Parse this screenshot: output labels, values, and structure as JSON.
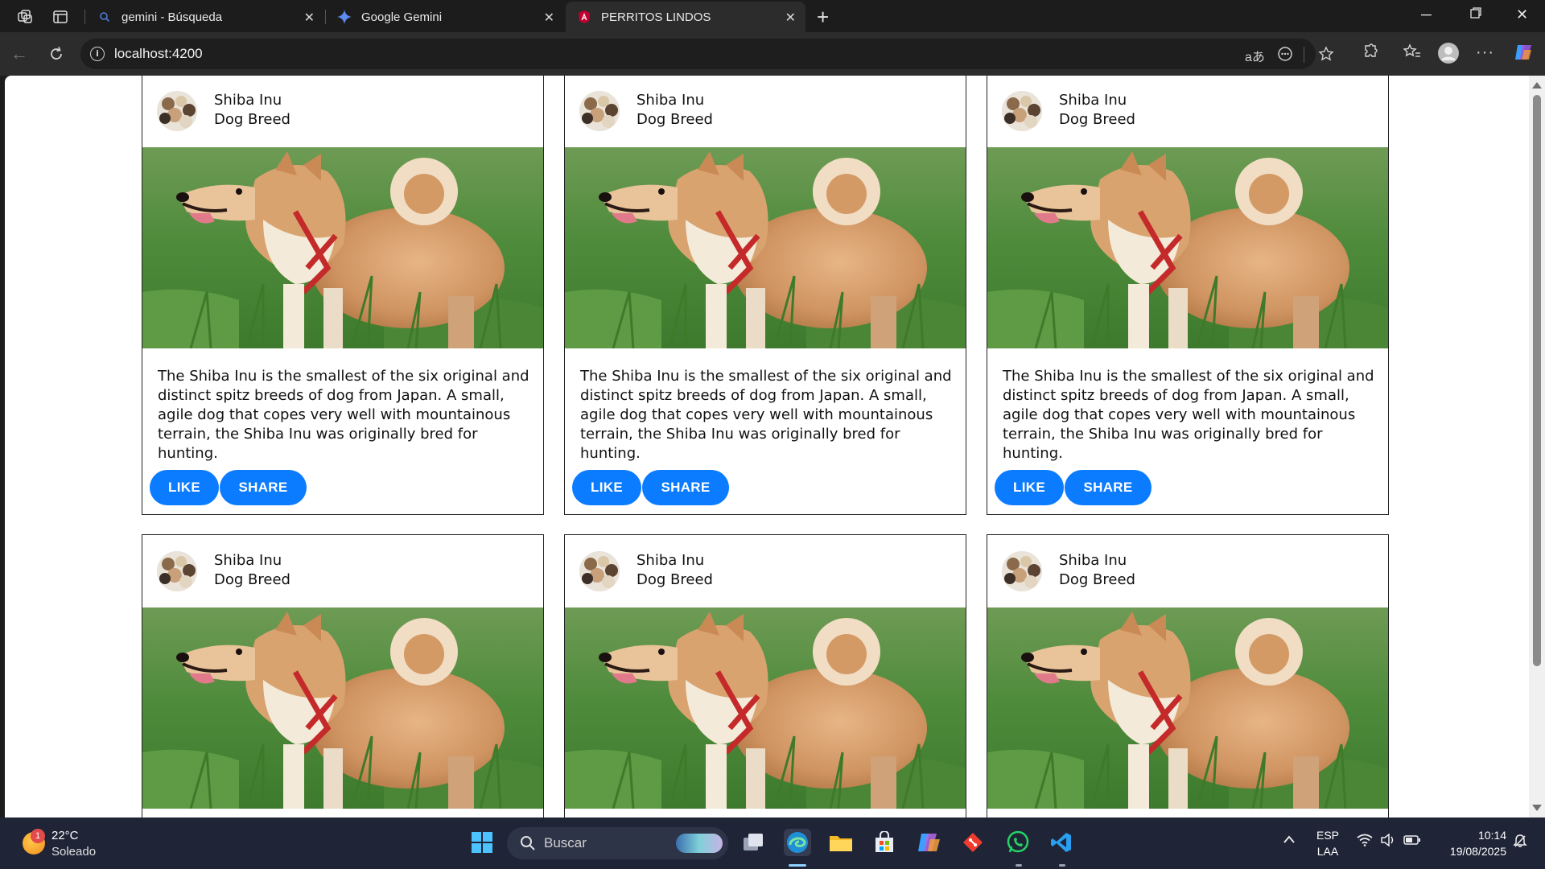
{
  "browser": {
    "tabs": [
      {
        "title": "gemini - Búsqueda",
        "favicon": "search-icon",
        "active": false
      },
      {
        "title": "Google Gemini",
        "favicon": "gemini-icon",
        "active": false
      },
      {
        "title": "PERRITOS LINDOS",
        "favicon": "angular-icon",
        "active": true
      }
    ],
    "url": "localhost:4200"
  },
  "cards": [
    {
      "title": "Shiba Inu",
      "subtitle": "Dog Breed",
      "description": "The Shiba Inu is the smallest of the six original and distinct spitz breeds of dog from Japan. A small, agile dog that copes very well with mountainous terrain, the Shiba Inu was originally bred for hunting.",
      "like_label": "LIKE",
      "share_label": "SHARE"
    },
    {
      "title": "Shiba Inu",
      "subtitle": "Dog Breed",
      "description": "The Shiba Inu is the smallest of the six original and distinct spitz breeds of dog from Japan. A small, agile dog that copes very well with mountainous terrain, the Shiba Inu was originally bred for hunting.",
      "like_label": "LIKE",
      "share_label": "SHARE"
    },
    {
      "title": "Shiba Inu",
      "subtitle": "Dog Breed",
      "description": "The Shiba Inu is the smallest of the six original and distinct spitz breeds of dog from Japan. A small, agile dog that copes very well with mountainous terrain, the Shiba Inu was originally bred for hunting.",
      "like_label": "LIKE",
      "share_label": "SHARE"
    },
    {
      "title": "Shiba Inu",
      "subtitle": "Dog Breed"
    },
    {
      "title": "Shiba Inu",
      "subtitle": "Dog Breed"
    },
    {
      "title": "Shiba Inu",
      "subtitle": "Dog Breed"
    }
  ],
  "colors": {
    "button": "#0b7bff",
    "taskbar": "#1f2437",
    "browser_chrome": "#2c2c2c"
  },
  "taskbar": {
    "weather": {
      "temp": "22°C",
      "condition": "Soleado",
      "badge": "1"
    },
    "search_placeholder": "Buscar",
    "language": "ESP",
    "layout": "LAA",
    "time": "10:14",
    "date": "19/08/2025"
  }
}
